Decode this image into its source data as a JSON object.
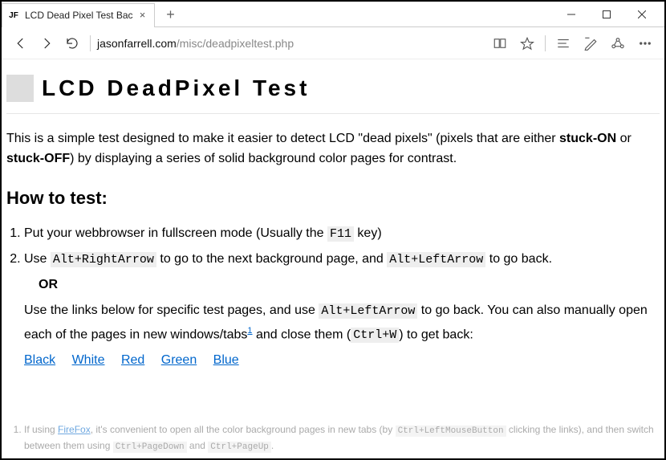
{
  "browser": {
    "tab_title": "LCD Dead Pixel Test Bac",
    "favicon_text": "JF",
    "url_host": "jasonfarrell.com",
    "url_path": "/misc/deadpixeltest.php"
  },
  "page": {
    "title": "LCD DeadPixel Test",
    "intro_before": "This is a simple test designed to make it easier to detect LCD \"dead pixels\" (pixels that are either ",
    "intro_stuck_on": "stuck-ON",
    "intro_mid": " or ",
    "intro_stuck_off": "stuck-OFF",
    "intro_after": ") by displaying a series of solid background color pages for contrast.",
    "howto_heading": "How to test:",
    "step1_a": "Put your webbrowser in fullscreen mode (Usually the ",
    "step1_kbd": "F11",
    "step1_b": " key)",
    "step2_a": "Use ",
    "step2_kbd1": "Alt+RightArrow",
    "step2_b": " to go to the next background page, and ",
    "step2_kbd2": "Alt+LeftArrow",
    "step2_c": " to go back.",
    "or_label": "OR",
    "step2_alt_a": "Use the links below for specific test pages, and use ",
    "step2_alt_kbd": "Alt+LeftArrow",
    "step2_alt_b": " to go back. You can also manually open each of the pages in new windows/tabs",
    "footref": "1",
    "step2_alt_c": " and close them (",
    "step2_alt_kbd2": "Ctrl+W",
    "step2_alt_d": ") to get back:",
    "colors": {
      "black": "Black",
      "white": "White",
      "red": "Red",
      "green": "Green",
      "blue": "Blue"
    },
    "footnote_a": "If using ",
    "footnote_link": "FireFox",
    "footnote_b": ", it's convenient to open all the color background pages in new tabs (by ",
    "footnote_kbd1": "Ctrl+LeftMouseButton",
    "footnote_c": " clicking the links), and then switch between them using ",
    "footnote_kbd2": "Ctrl+PageDown",
    "footnote_d": " and ",
    "footnote_kbd3": "Ctrl+PageUp",
    "footnote_e": "."
  }
}
